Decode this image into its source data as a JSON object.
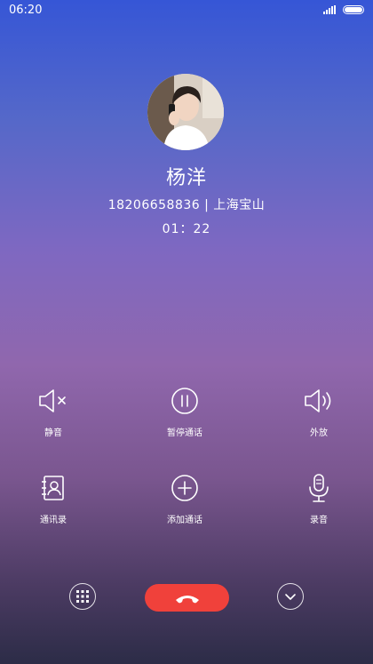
{
  "status_bar": {
    "time": "06:20"
  },
  "caller": {
    "name": "杨洋",
    "number": "18206658836",
    "separator": "|",
    "location": "上海宝山",
    "duration": "01：22"
  },
  "controls": {
    "mute": {
      "label": "静音",
      "icon": "mute-speaker-icon"
    },
    "hold": {
      "label": "暂停通话",
      "icon": "pause-icon"
    },
    "speaker": {
      "label": "外放",
      "icon": "speaker-icon"
    },
    "contacts": {
      "label": "通讯录",
      "icon": "contacts-book-icon"
    },
    "add_call": {
      "label": "添加通话",
      "icon": "plus-circle-icon"
    },
    "record": {
      "label": "录音",
      "icon": "microphone-icon"
    }
  },
  "bottom_bar": {
    "keypad_icon": "dialpad-icon",
    "hangup_icon": "phone-hangup-icon",
    "collapse_icon": "chevron-down-icon"
  },
  "colors": {
    "hangup": "#f0413b",
    "background_top": "#3656d6",
    "background_mid": "#9067ad",
    "background_bottom": "#2c2c47"
  }
}
